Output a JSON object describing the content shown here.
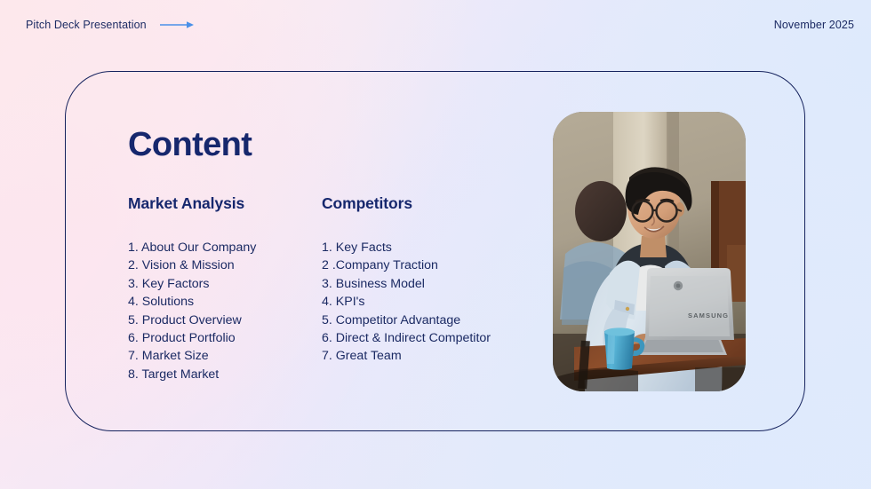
{
  "slide": {
    "header": {
      "kicker": "Pitch Deck Presentation",
      "arrow_icon": "arrow-right-icon",
      "date": "November 2025",
      "arrow_color": "#4a90e8"
    },
    "title": "Content",
    "colors": {
      "navy": "#16276d",
      "text_navy": "#1b2a63",
      "card_border": "#16235e",
      "bg_pink": "#fdeef1",
      "bg_lavender": "#ece8fa",
      "bg_blue": "#e2ebfb",
      "accent_blue": "#4a90e8"
    },
    "columns": [
      {
        "heading": "Market Analysis",
        "items": [
          "1. About Our Company",
          "2. Vision & Mission",
          "3. Key Factors",
          "4. Solutions",
          "5. Product Overview",
          "6. Product Portfolio",
          "7. Market Size",
          "8. Target Market"
        ]
      },
      {
        "heading": "Competitors",
        "items": [
          "1. Key Facts",
          "2 .Company Traction",
          "3. Business Model",
          "4. KPI's",
          "5. Competitor Advantage",
          "6. Direct & Indirect Competitor",
          "7. Great Team"
        ]
      }
    ],
    "photo": {
      "name": "person-with-laptop-photo",
      "description": "Smiling person wearing glasses and a light denim jacket working on a Samsung Chromebook laptop at a wooden cafe table with a blue mug",
      "laptop_brand": "SAMSUNG"
    }
  }
}
